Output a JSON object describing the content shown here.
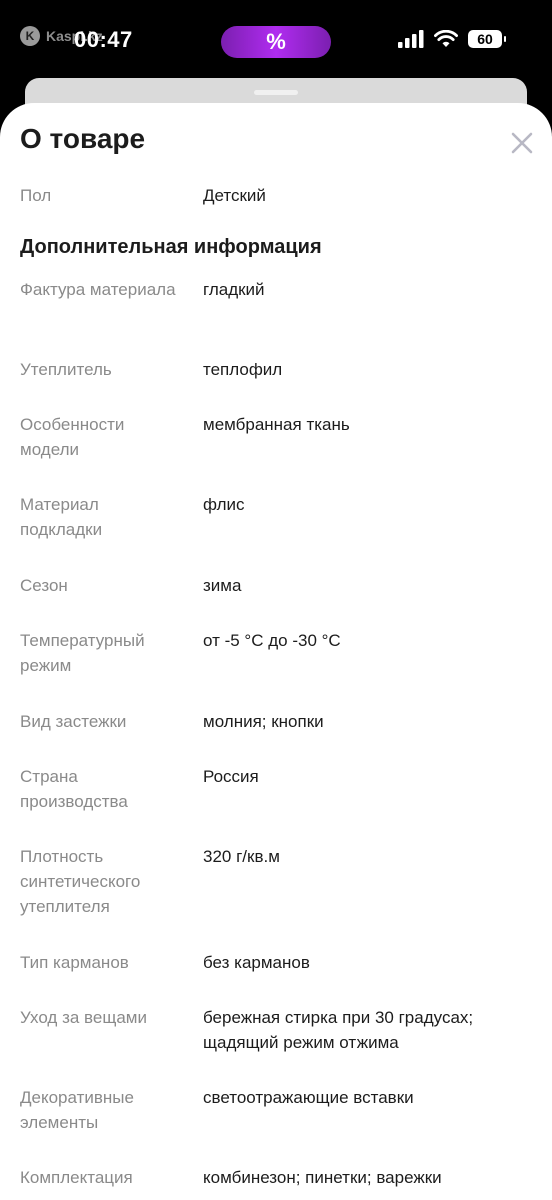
{
  "status_bar": {
    "carrier": "Kaspi.kz",
    "time": "00:47",
    "island_symbol": "%",
    "battery": "60",
    "icons": [
      "signal-icon",
      "wifi-icon",
      "battery-icon"
    ]
  },
  "sheet": {
    "title": "О товаре",
    "close_icon": "close-icon",
    "top_rows": [
      {
        "label": "Пол",
        "value": "Детский"
      }
    ],
    "section_title": "Дополнительная информация",
    "rows": [
      {
        "label": "Фактура материала",
        "value": "гладкий"
      },
      {
        "label": "Утеплитель",
        "value": "теплофил"
      },
      {
        "label": "Особенности модели",
        "value": "мембранная ткань"
      },
      {
        "label": "Материал подкладки",
        "value": "флис"
      },
      {
        "label": "Сезон",
        "value": "зима"
      },
      {
        "label": "Температурный режим",
        "value": "от -5 °C до -30 °C"
      },
      {
        "label": "Вид застежки",
        "value": "молния; кнопки"
      },
      {
        "label": "Страна производства",
        "value": "Россия"
      },
      {
        "label": "Плотность синтетического утеплителя",
        "value": "320 г/кв.м"
      },
      {
        "label": "Тип карманов",
        "value": "без карманов"
      },
      {
        "label": "Уход за вещами",
        "value": "бережная стирка при 30 градусах; щадящий режим отжима"
      },
      {
        "label": "Декоративные элементы",
        "value": "светоотражающие вставки"
      },
      {
        "label": "Комплектация",
        "value": "комбинезон; пинетки; варежки"
      }
    ]
  }
}
